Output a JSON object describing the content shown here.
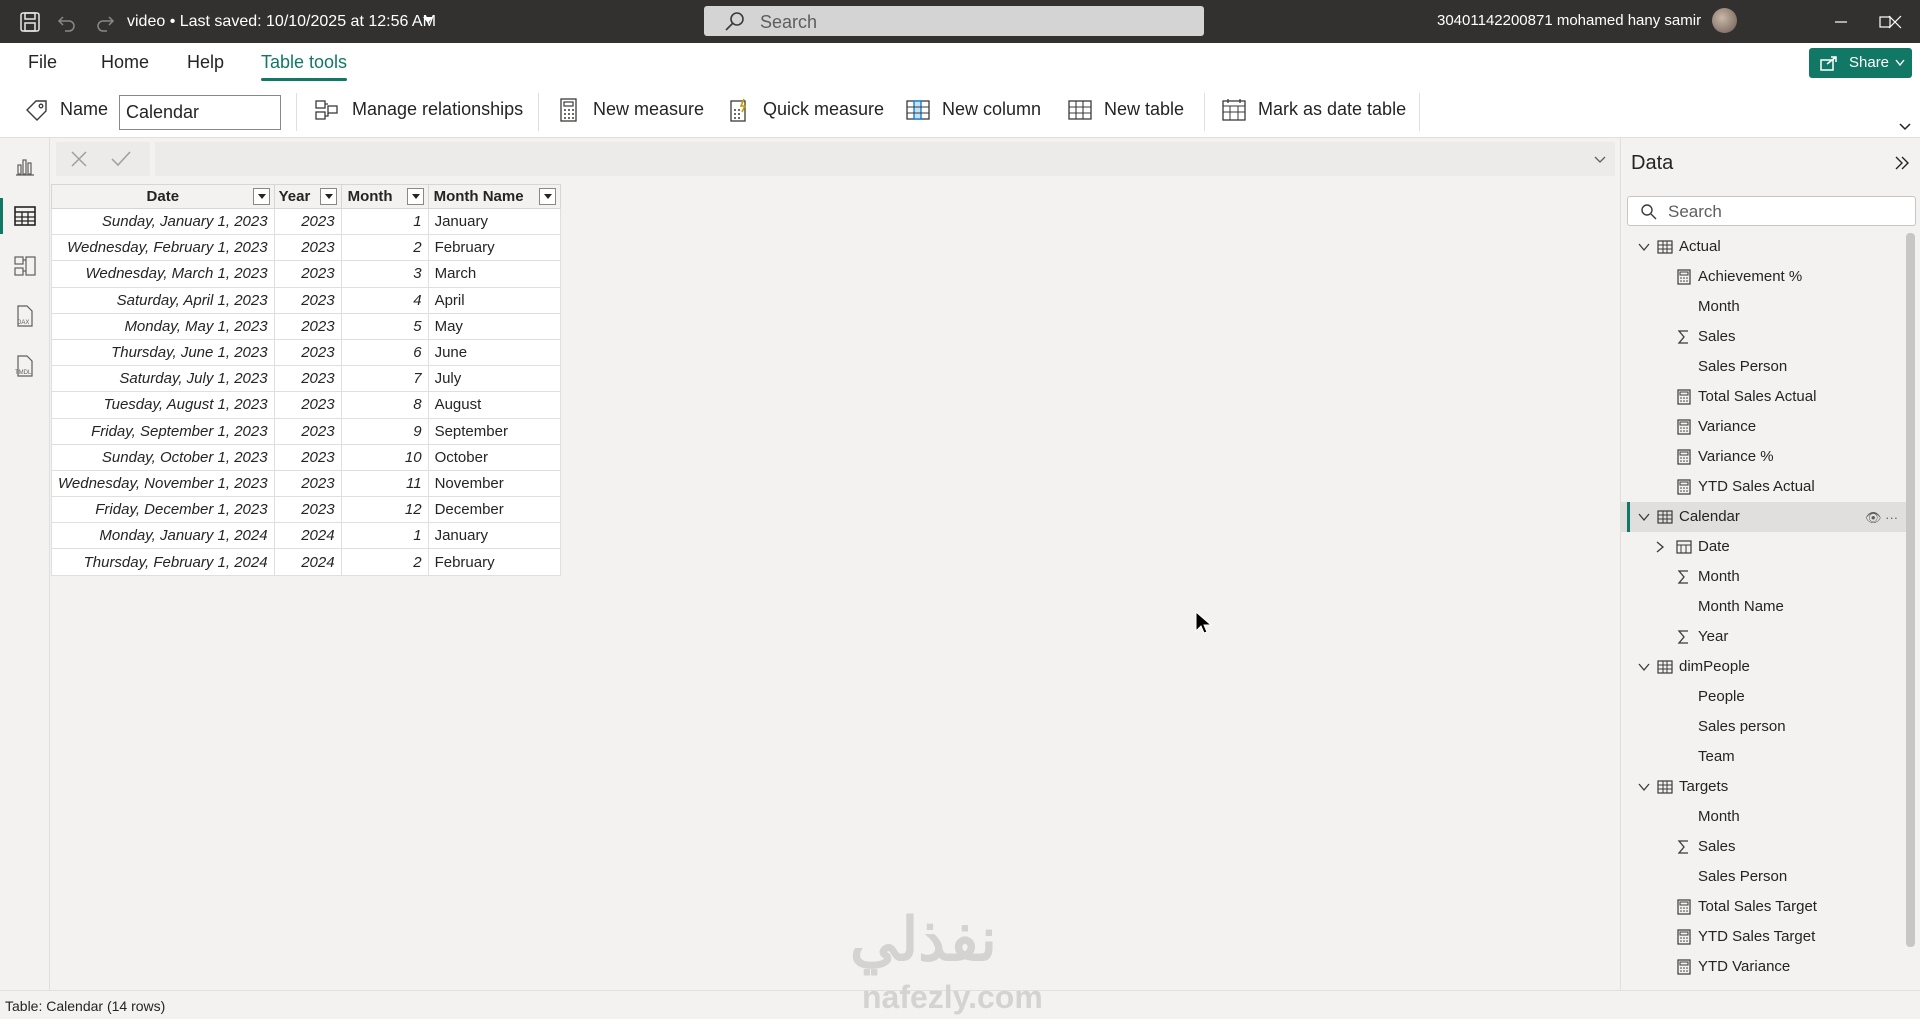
{
  "titlebar": {
    "title": "video • Last saved: 10/10/2025 at 12:56 AM",
    "search_placeholder": "Search",
    "user": "30401142200871 mohamed hany samir"
  },
  "menu": {
    "file": "File",
    "home": "Home",
    "help": "Help",
    "table_tools": "Table tools",
    "share": "Share"
  },
  "toolbar": {
    "name_label": "Name",
    "name_value": "Calendar",
    "manage_relationships": "Manage relationships",
    "new_measure": "New measure",
    "quick_measure": "Quick measure",
    "new_column": "New column",
    "new_table": "New table",
    "mark_as_date_table": "Mark as date table"
  },
  "table": {
    "headers": [
      "Date",
      "Year",
      "Month",
      "Month Name"
    ],
    "rows": [
      [
        "Sunday, January 1, 2023",
        "2023",
        "1",
        "January"
      ],
      [
        "Wednesday, February 1, 2023",
        "2023",
        "2",
        "February"
      ],
      [
        "Wednesday, March 1, 2023",
        "2023",
        "3",
        "March"
      ],
      [
        "Saturday, April 1, 2023",
        "2023",
        "4",
        "April"
      ],
      [
        "Monday, May 1, 2023",
        "2023",
        "5",
        "May"
      ],
      [
        "Thursday, June 1, 2023",
        "2023",
        "6",
        "June"
      ],
      [
        "Saturday, July 1, 2023",
        "2023",
        "7",
        "July"
      ],
      [
        "Tuesday, August 1, 2023",
        "2023",
        "8",
        "August"
      ],
      [
        "Friday, September 1, 2023",
        "2023",
        "9",
        "September"
      ],
      [
        "Sunday, October 1, 2023",
        "2023",
        "10",
        "October"
      ],
      [
        "Wednesday, November 1, 2023",
        "2023",
        "11",
        "November"
      ],
      [
        "Friday, December 1, 2023",
        "2023",
        "12",
        "December"
      ],
      [
        "Monday, January 1, 2024",
        "2024",
        "1",
        "January"
      ],
      [
        "Thursday, February 1, 2024",
        "2024",
        "2",
        "February"
      ]
    ]
  },
  "data_pane": {
    "title": "Data",
    "search_placeholder": "Search",
    "tree": [
      {
        "label": "Actual",
        "type": "table",
        "expanded": true,
        "level": 0
      },
      {
        "label": "Achievement %",
        "type": "measure",
        "level": 1
      },
      {
        "label": "Month",
        "type": "field",
        "level": 1
      },
      {
        "label": "Sales",
        "type": "sum",
        "level": 1
      },
      {
        "label": "Sales Person",
        "type": "field",
        "level": 1
      },
      {
        "label": "Total Sales Actual",
        "type": "measure",
        "level": 1
      },
      {
        "label": "Variance",
        "type": "measure",
        "level": 1
      },
      {
        "label": "Variance %",
        "type": "measure",
        "level": 1
      },
      {
        "label": "YTD Sales Actual",
        "type": "measure",
        "level": 1
      },
      {
        "label": "Calendar",
        "type": "table",
        "expanded": true,
        "level": 0,
        "selected": true
      },
      {
        "label": "Date",
        "type": "hierarchy",
        "level": 1
      },
      {
        "label": "Month",
        "type": "sum",
        "level": 1
      },
      {
        "label": "Month Name",
        "type": "field",
        "level": 1
      },
      {
        "label": "Year",
        "type": "sum",
        "level": 1
      },
      {
        "label": "dimPeople",
        "type": "table",
        "expanded": true,
        "level": 0
      },
      {
        "label": "People",
        "type": "field",
        "level": 1
      },
      {
        "label": "Sales person",
        "type": "field",
        "level": 1
      },
      {
        "label": "Team",
        "type": "field",
        "level": 1
      },
      {
        "label": "Targets",
        "type": "table",
        "expanded": true,
        "level": 0
      },
      {
        "label": "Month",
        "type": "field",
        "level": 1
      },
      {
        "label": "Sales",
        "type": "sum",
        "level": 1
      },
      {
        "label": "Sales Person",
        "type": "field",
        "level": 1
      },
      {
        "label": "Total Sales Target",
        "type": "measure",
        "level": 1
      },
      {
        "label": "YTD Sales Target",
        "type": "measure",
        "level": 1
      },
      {
        "label": "YTD Variance",
        "type": "measure",
        "level": 1
      }
    ]
  },
  "status": {
    "text": "Table: Calendar (14 rows)"
  },
  "watermark": {
    "arabic": "نفذلي",
    "latin": "nafezly.com"
  },
  "colors": {
    "accent": "#117865",
    "titlebar": "#323130"
  }
}
